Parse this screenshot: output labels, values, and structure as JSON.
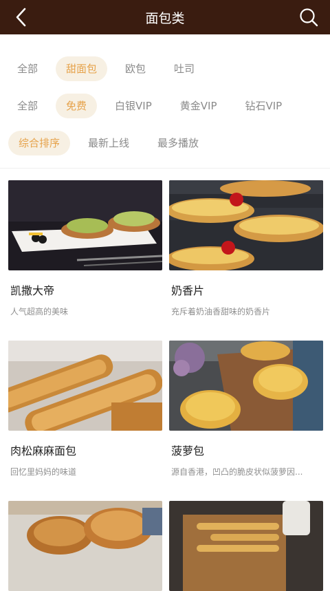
{
  "header": {
    "title": "面包类",
    "back_icon": "back-arrow-icon",
    "search_icon": "search-icon"
  },
  "filters": {
    "category": [
      "全部",
      "甜面包",
      "欧包",
      "吐司"
    ],
    "category_selected": "甜面包",
    "price": [
      "全部",
      "免费",
      "白银VIP",
      "黄金VIP",
      "钻石VIP"
    ],
    "price_selected": "免费",
    "sort": [
      "综合排序",
      "最新上线",
      "最多播放"
    ],
    "sort_selected": "综合排序"
  },
  "items": [
    {
      "name": "凯撒大帝",
      "desc": "人气超高的美味"
    },
    {
      "name": "奶香片",
      "desc": "充斥着奶油香甜味的奶香片"
    },
    {
      "name": "肉松麻麻面包",
      "desc": "回忆里妈妈的味道"
    },
    {
      "name": "菠萝包",
      "desc": "源自香港，凹凸的脆皮状似菠萝因..."
    },
    {
      "name": "",
      "desc": ""
    },
    {
      "name": "",
      "desc": ""
    }
  ],
  "colors": {
    "header_bg": "#3a1c10",
    "accent": "#e6a24a",
    "chip_bg": "#f7f0e3"
  }
}
